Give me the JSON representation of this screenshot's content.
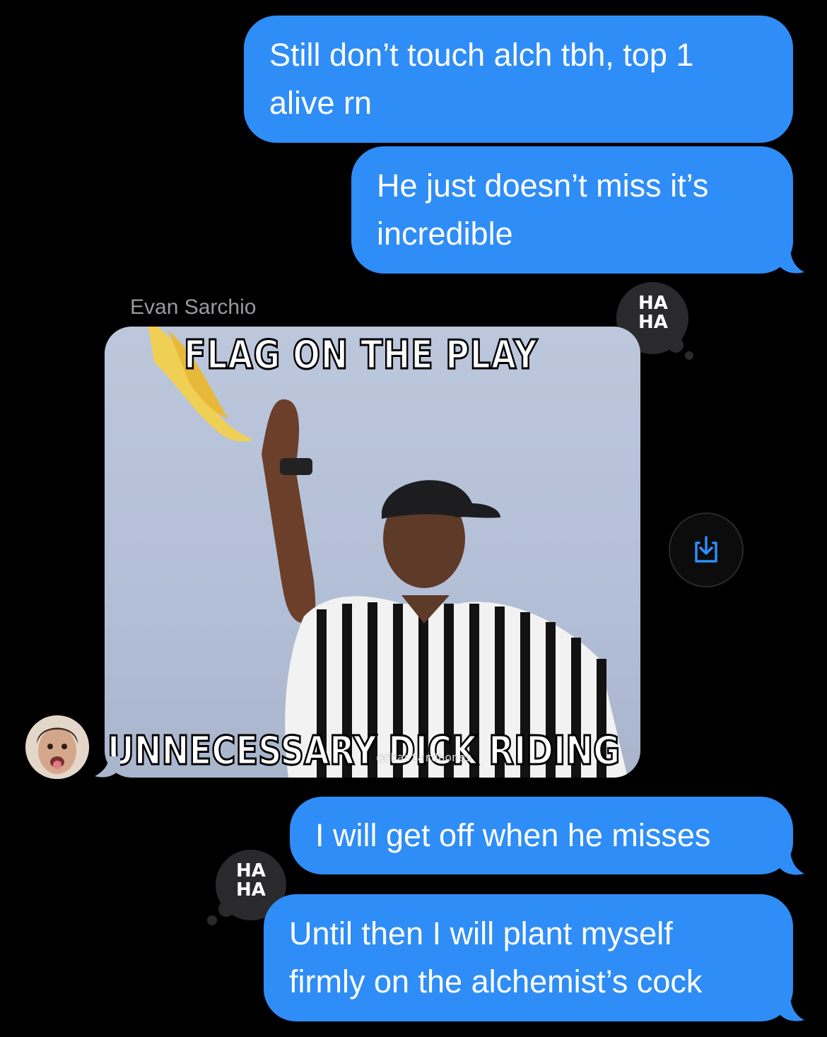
{
  "messages": [
    {
      "text_line1": "Still don’t touch alch tbh, top 1",
      "text_line2": "alive rn"
    },
    {
      "text_line1": "He just doesn’t miss it’s",
      "text_line2": "incredible"
    },
    {
      "text_line1": "I will get off when he misses"
    },
    {
      "text_line1": "Until then I will plant myself",
      "text_line2": "firmly on the alchemist’s cock"
    }
  ],
  "sender_name": "Evan Sarchio",
  "meme": {
    "top_caption": "FLAG ON THE PLAY",
    "bottom_caption": "UNNECESSARY DICK RIDING",
    "watermark": "@@bastardbones"
  },
  "reactions": {
    "haha_line1": "HA",
    "haha_line2": "HA"
  },
  "icons": {
    "download": "download-icon",
    "reaction": "haha-reaction-icon",
    "avatar": "contact-avatar"
  },
  "colors": {
    "outgoing_bubble": "#2f8df7",
    "background": "#000000",
    "sender_name": "#9a9a9f",
    "accent": "#2f8df7"
  }
}
